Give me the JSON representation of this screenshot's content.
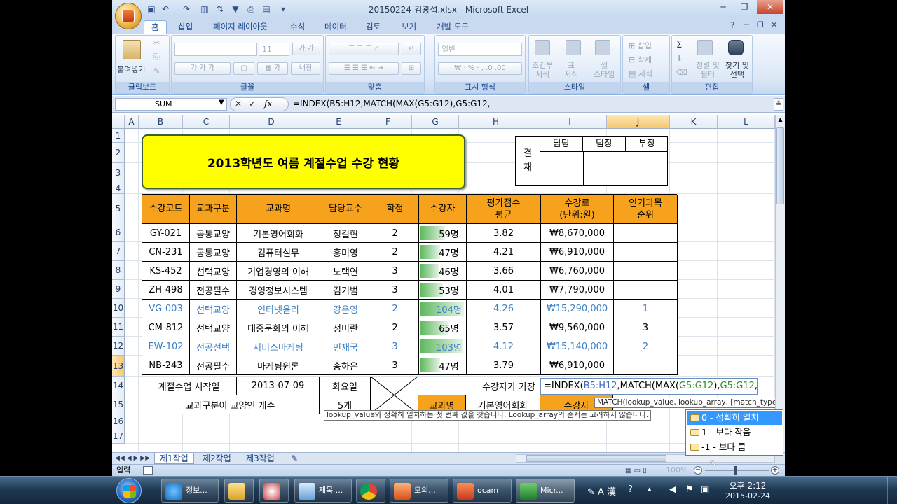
{
  "window": {
    "title": "20150224-김광섭.xlsx - Microsoft Excel"
  },
  "ribbon": {
    "tabs": [
      "홈",
      "삽입",
      "페이지 레이아웃",
      "수식",
      "데이터",
      "검토",
      "보기",
      "개발 도구"
    ],
    "active_tab": "홈",
    "clipboard": {
      "paste_label": "붙여넣기",
      "group": "클립보드"
    },
    "font": {
      "size": "11",
      "group": "글꼴"
    },
    "alignment": {
      "group": "맞춤"
    },
    "number": {
      "format": "일반",
      "group": "표시 형식"
    },
    "styles": {
      "conditional": "조건부\n서식",
      "table": "표\n서식",
      "cell": "셀\n스타일",
      "group": "스타일"
    },
    "cells": {
      "insert": "삽입",
      "delete": "삭제",
      "format": "서식",
      "group": "셀"
    },
    "editing": {
      "sort": "정렬 및\n필터",
      "find": "찾기 및\n선택",
      "group": "편집"
    }
  },
  "formula_bar": {
    "name_box": "SUM",
    "formula": "=INDEX(B5:H12,MATCH(MAX(G5:G12),G5:G12,"
  },
  "grid": {
    "columns": [
      "A",
      "B",
      "C",
      "D",
      "E",
      "F",
      "G",
      "H",
      "I",
      "J",
      "K",
      "L"
    ],
    "rows": [
      "1",
      "2",
      "3",
      "4",
      "5",
      "6",
      "7",
      "8",
      "9",
      "10",
      "11",
      "12",
      "13",
      "14",
      "15",
      "16",
      "17"
    ],
    "title": "2013학년도 여름 계절수업 수강 현황",
    "approval": {
      "label": "결\n재",
      "heads": [
        "담당",
        "팀장",
        "부장"
      ]
    },
    "headers": [
      "수강코드",
      "교과구분",
      "교과명",
      "담당교수",
      "학점",
      "수강자",
      "평가점수\n평균",
      "수강료\n(단위:원)",
      "인기과목\n순위"
    ],
    "data": [
      {
        "code": "GY-021",
        "type": "공통교양",
        "name": "기본영어회화",
        "prof": "정길현",
        "credit": "2",
        "students": "59명",
        "score": "3.82",
        "fee": "₩8,670,000",
        "rank": "",
        "blue": false,
        "bar": 0.57
      },
      {
        "code": "CN-231",
        "type": "공통교양",
        "name": "컴퓨터실무",
        "prof": "홍미영",
        "credit": "2",
        "students": "47명",
        "score": "4.21",
        "fee": "₩6,910,000",
        "rank": "",
        "blue": false,
        "bar": 0.45
      },
      {
        "code": "KS-452",
        "type": "선택교양",
        "name": "기업경영의 이해",
        "prof": "노택연",
        "credit": "3",
        "students": "46명",
        "score": "3.66",
        "fee": "₩6,760,000",
        "rank": "",
        "blue": false,
        "bar": 0.44
      },
      {
        "code": "ZH-498",
        "type": "전공필수",
        "name": "경영정보시스템",
        "prof": "김기범",
        "credit": "3",
        "students": "53명",
        "score": "4.01",
        "fee": "₩7,790,000",
        "rank": "",
        "blue": false,
        "bar": 0.51
      },
      {
        "code": "VG-003",
        "type": "선택교양",
        "name": "인터넷윤리",
        "prof": "강은영",
        "credit": "2",
        "students": "104명",
        "score": "4.26",
        "fee": "₩15,290,000",
        "rank": "1",
        "blue": true,
        "bar": 1.0
      },
      {
        "code": "CM-812",
        "type": "선택교양",
        "name": "대중문화의 이해",
        "prof": "정미란",
        "credit": "2",
        "students": "65명",
        "score": "3.57",
        "fee": "₩9,560,000",
        "rank": "3",
        "blue": false,
        "bar": 0.63
      },
      {
        "code": "EW-102",
        "type": "전공선택",
        "name": "서비스마케팅",
        "prof": "민재국",
        "credit": "3",
        "students": "103명",
        "score": "4.12",
        "fee": "₩15,140,000",
        "rank": "2",
        "blue": true,
        "bar": 0.99
      },
      {
        "code": "NB-243",
        "type": "전공필수",
        "name": "마케팅원론",
        "prof": "송하은",
        "credit": "3",
        "students": "47명",
        "score": "3.79",
        "fee": "₩6,910,000",
        "rank": "",
        "blue": false,
        "bar": 0.45
      }
    ],
    "summary": {
      "start_label": "계절수업 시작일",
      "start_date": "2013-07-09",
      "start_day": "화요일",
      "count_label": "교과구분이 교양인 개수",
      "count_value": "5개",
      "most_label": "수강자가 가장",
      "edit_prefix": "=INDEX(",
      "edit_r1": "B5:H12",
      "edit_mid": ",MATCH(MAX(",
      "edit_r2": "G5:G12",
      "edit_mid2": "),",
      "edit_r3": "G5:G12",
      "edit_end": ",",
      "subj_label": "교과명",
      "subj_value": "기본영어회화",
      "students_label": "수강자"
    }
  },
  "tooltips": {
    "signature": "MATCH(lookup_value, lookup_array, [match_type])",
    "description": "lookup_value와 정확히 일치하는 첫 번째 값을 찾습니다. Lookup_array의 순서는 고려하지 않습니다."
  },
  "autocomplete": [
    "0 - 정확히 일치",
    "1 - 보다 작음",
    "-1 - 보다 큼"
  ],
  "sheets": {
    "tabs": [
      "제1작업",
      "제2작업",
      "제3작업"
    ],
    "active": 0
  },
  "status": {
    "mode": "입력",
    "zoom": "100%"
  },
  "taskbar": {
    "items": [
      "정보...",
      "",
      "제목 ...",
      "",
      "모의...",
      "ocam",
      "Micr..."
    ],
    "time": "오후 2:12",
    "date": "2015-02-24",
    "tray": "A 漢"
  },
  "colors": {
    "header_orange": "#f7a21c",
    "title_yellow": "#ffff00",
    "link_blue": "#3c7fc4"
  }
}
